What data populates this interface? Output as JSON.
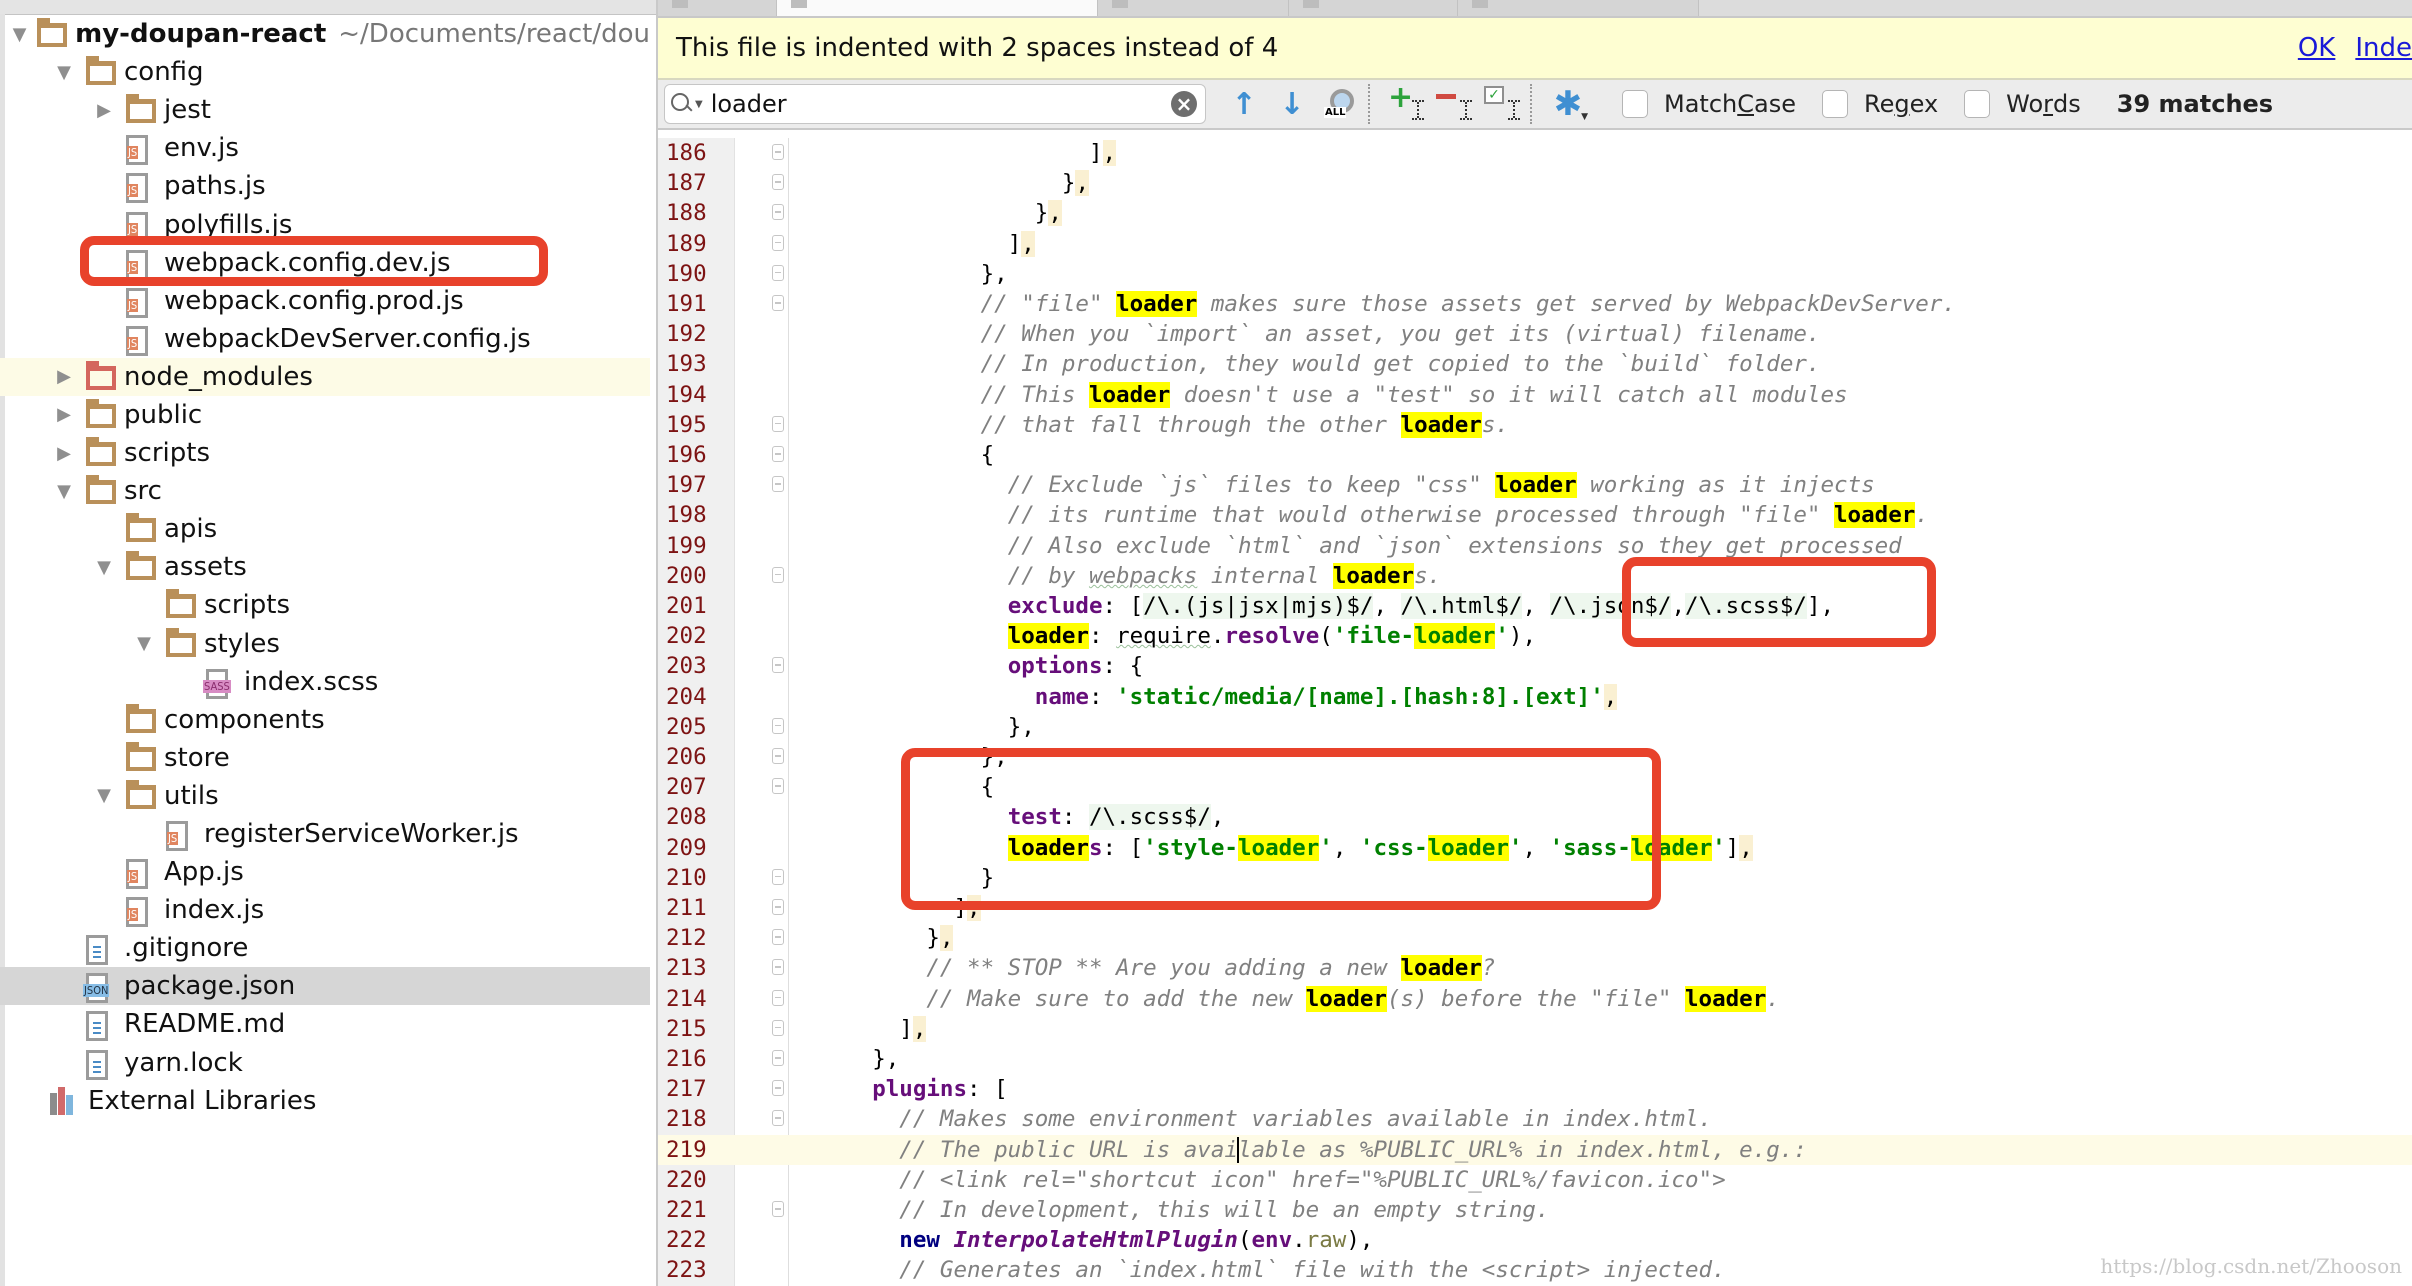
{
  "sidebar": {
    "project_name": "my-doupan-react",
    "project_path": "~/Documents/react/dou",
    "items": [
      {
        "label": "config"
      },
      {
        "label": "jest"
      },
      {
        "label": "env.js"
      },
      {
        "label": "paths.js"
      },
      {
        "label": "polyfills.js"
      },
      {
        "label": "webpack.config.dev.js"
      },
      {
        "label": "webpack.config.prod.js"
      },
      {
        "label": "webpackDevServer.config.js"
      },
      {
        "label": "node_modules"
      },
      {
        "label": "public"
      },
      {
        "label": "scripts"
      },
      {
        "label": "src"
      },
      {
        "label": "apis"
      },
      {
        "label": "assets"
      },
      {
        "label": "scripts"
      },
      {
        "label": "styles"
      },
      {
        "label": "index.scss"
      },
      {
        "label": "components"
      },
      {
        "label": "store"
      },
      {
        "label": "utils"
      },
      {
        "label": "registerServiceWorker.js"
      },
      {
        "label": "App.js"
      },
      {
        "label": "index.js"
      },
      {
        "label": ".gitignore"
      },
      {
        "label": "package.json"
      },
      {
        "label": "README.md"
      },
      {
        "label": "yarn.lock"
      },
      {
        "label": "External Libraries"
      }
    ],
    "badges": {
      "js": "JS",
      "json": "JSON",
      "sass": "SASS"
    }
  },
  "notification": {
    "message": "This file is indented with 2 spaces instead of 4",
    "ok_label": "OK",
    "indent_label": "Inde"
  },
  "search": {
    "query": "loader",
    "all_label": "ALL",
    "match_case_label": "Match ",
    "match_case_mnemonic": "C",
    "match_case_rest": "ase",
    "regex_label": "Re",
    "regex_mnemonic": "g",
    "regex_rest": "ex",
    "words_label": "Wo",
    "words_mnemonic": "r",
    "words_rest": "ds",
    "match_count": "39 matches"
  },
  "code": {
    "current_line": 219,
    "lines": [
      {
        "n": "186"
      },
      {
        "n": "187"
      },
      {
        "n": "188"
      },
      {
        "n": "189"
      },
      {
        "n": "190"
      },
      {
        "n": "191"
      },
      {
        "n": "192"
      },
      {
        "n": "193"
      },
      {
        "n": "194"
      },
      {
        "n": "195"
      },
      {
        "n": "196"
      },
      {
        "n": "197"
      },
      {
        "n": "198"
      },
      {
        "n": "199"
      },
      {
        "n": "200"
      },
      {
        "n": "201"
      },
      {
        "n": "202"
      },
      {
        "n": "203"
      },
      {
        "n": "204"
      },
      {
        "n": "205"
      },
      {
        "n": "206"
      },
      {
        "n": "207"
      },
      {
        "n": "208"
      },
      {
        "n": "209"
      },
      {
        "n": "210"
      },
      {
        "n": "211"
      },
      {
        "n": "212"
      },
      {
        "n": "213"
      },
      {
        "n": "214"
      },
      {
        "n": "215"
      },
      {
        "n": "216"
      },
      {
        "n": "217"
      },
      {
        "n": "218"
      },
      {
        "n": "219"
      },
      {
        "n": "220"
      },
      {
        "n": "221"
      },
      {
        "n": "222"
      },
      {
        "n": "223"
      }
    ],
    "t": {
      "l186": "],",
      "l187": "},",
      "l188": "},",
      "l189": "],",
      "l190": "},",
      "l191a": "// \"file\" ",
      "l191b": "loader",
      "l191c": " makes sure those assets get served by WebpackDevServer.",
      "l192": "// When you `import` an asset, you get its (virtual) filename.",
      "l193": "// In production, they would get copied to the `build` folder.",
      "l194a": "// This ",
      "l194b": "loader",
      "l194c": " doesn't use a \"test\" so it will catch all modules",
      "l195a": "// that fall through the other ",
      "l195b": "loader",
      "l195c": "s.",
      "l196": "{",
      "l197a": "// Exclude `js` files to keep \"css\" ",
      "l197b": "loader",
      "l197c": " working as it injects",
      "l198a": "// its runtime that would otherwise processed through \"file\" ",
      "l198b": "loader",
      "l198c": ".",
      "l199": "// Also exclude `html` and `json` extensions so they get processed",
      "l200a": "// by ",
      "l200b": "webpacks",
      "l200c": " internal ",
      "l200d": "loader",
      "l200e": "s.",
      "l201key": "exclude",
      "l201colon": ": [",
      "l201r1": "/\\.(js|jsx|mjs)$/",
      "l201r2": "/\\.html$/",
      "l201r3": "/\\.json$/",
      "l201r4": "/\\.scss$/",
      "l201end": "],",
      "l202key": "loader",
      "l202colon": ": ",
      "l202req": "require",
      "l202dot": ".",
      "l202res": "resolve",
      "l202op": "(",
      "l202s1": "'file-",
      "l202s2": "loader",
      "l202s3": "'",
      "l202end": "),",
      "l203key": "options",
      "l203rest": ": {",
      "l204key": "name",
      "l204colon": ": ",
      "l204str": "'static/media/[name].[hash:8].[ext]'",
      "l204end": ",",
      "l205": "},",
      "l206": "},",
      "l207": "{",
      "l208key": "test",
      "l208colon": ": ",
      "l208rx": "/\\.scss$/",
      "l208end": ",",
      "l209a": "loader",
      "l209b": "s",
      "l209colon": ": [",
      "l209s1a": "'style-",
      "l209s1b": "loader",
      "l209s1c": "'",
      "l209s2a": "'css-",
      "l209s2b": "loader",
      "l209s2c": "'",
      "l209s3a": "'sass-",
      "l209s3b": "loader",
      "l209s3c": "'",
      "l209end": "],",
      "l210": "}",
      "l211": "],",
      "l212": "},",
      "l213a": "// ** STOP ** Are you adding a new ",
      "l213b": "loader",
      "l213c": "?",
      "l214a": "// Make sure to add the new ",
      "l214b": "loader",
      "l214c": "(s) before the \"file\" ",
      "l214d": "loader",
      "l214e": ".",
      "l215": "],",
      "l216": "},",
      "l217key": "plugins",
      "l217rest": ": [",
      "l218": "// Makes some environment variables available in index.html.",
      "l219a": "// The public URL is avai",
      "l219b": "lable as %PUBLIC_URL% in index.html, e.g.:",
      "l220": "// <link rel=\"shortcut icon\" href=\"%PUBLIC_URL%/favicon.ico\">",
      "l221": "// In development, this will be an empty string.",
      "l222new": "new ",
      "l222cls": "InterpolateHtmlPlugin",
      "l222op": "(",
      "l222env": "env",
      "l222dot": ".",
      "l222raw": "raw",
      "l222end": "),",
      "l223": "// Generates an `index.html` file with the <script> injected."
    }
  },
  "watermark": "https://blog.csdn.net/Zhooson",
  "colors": {
    "annotation_red": "#e8422b",
    "search_highlight": "#ffff00",
    "notification_bg": "#fefed2",
    "line_number": "#7d1313"
  }
}
